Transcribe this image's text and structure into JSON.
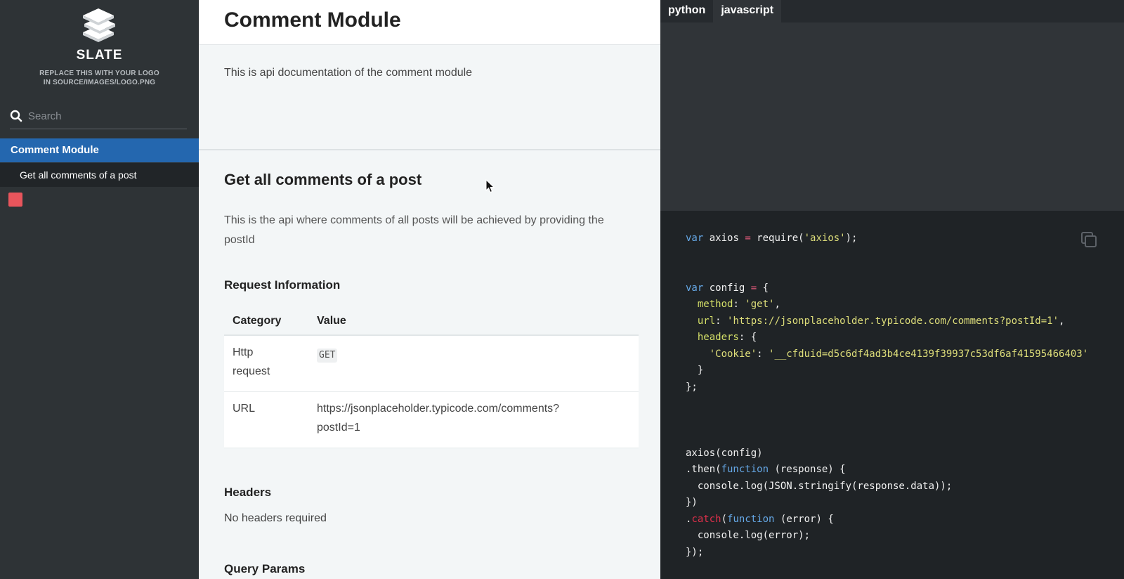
{
  "sidebar": {
    "brand": "SLATE",
    "logo_note_line1": "REPLACE THIS WITH YOUR LOGO",
    "logo_note_line2": "IN SOURCE/IMAGES/LOGO.PNG",
    "search_placeholder": "Search",
    "nav_items": [
      {
        "label": "Comment Module"
      },
      {
        "label": "Get all comments of a post"
      }
    ],
    "accent_color": "#2467af"
  },
  "content": {
    "page_title": "Comment Module",
    "intro": "This is api documentation of the comment module",
    "section_title": "Get all comments of a post",
    "section_desc": "This is the api where comments of all posts will be achieved by providing the postId",
    "request_info_title": "Request Information",
    "table": {
      "headers": [
        "Category",
        "Value"
      ],
      "rows": [
        {
          "category_line1": "Http",
          "category_line2": "request",
          "value": "GET"
        },
        {
          "category_line1": "URL",
          "value_line1": "https://jsonplaceholder.typicode.com/comments?",
          "value_line2": "postId=1"
        }
      ]
    },
    "headers_title": "Headers",
    "headers_text": "No headers required",
    "query_params_title": "Query Params"
  },
  "code_panel": {
    "tabs": [
      "python",
      "javascript"
    ],
    "active_tab": "javascript",
    "code": {
      "l1_var": "var",
      "l1_name": " axios ",
      "l1_eq": "=",
      "l1_req": " require(",
      "l1_str": "'axios'",
      "l1_end": ");",
      "l2_var": "var",
      "l2_name": " config ",
      "l2_eq": "=",
      "l2_open": " {",
      "l3_prop": "method",
      "l3_colon": ": ",
      "l3_str": "'get'",
      "l3_comma": ",",
      "l4_prop": "url",
      "l4_colon": ": ",
      "l4_str": "'https://jsonplaceholder.typicode.com/comments?postId=1'",
      "l4_comma": ",",
      "l5_prop": "headers",
      "l5_rest": ": {",
      "l6_str1": "'Cookie'",
      "l6_colon": ": ",
      "l6_str2": "'__cfduid=d5c6df4ad3b4ce4139f39937c53df6af41595466403'",
      "l7": "}",
      "l8": "};",
      "l9": "axios(config)",
      "l10_dot": ".then(",
      "l10_fn": "function",
      "l10_rest": " (response) {",
      "l11": "console.log(JSON.stringify(response.data));",
      "l12": "})",
      "l13_dot": ".",
      "l13_catch": "catch",
      "l13_paren": "(",
      "l13_fn": "function",
      "l13_rest": " (error) {",
      "l14": "console.log(error);",
      "l15": "});"
    }
  }
}
